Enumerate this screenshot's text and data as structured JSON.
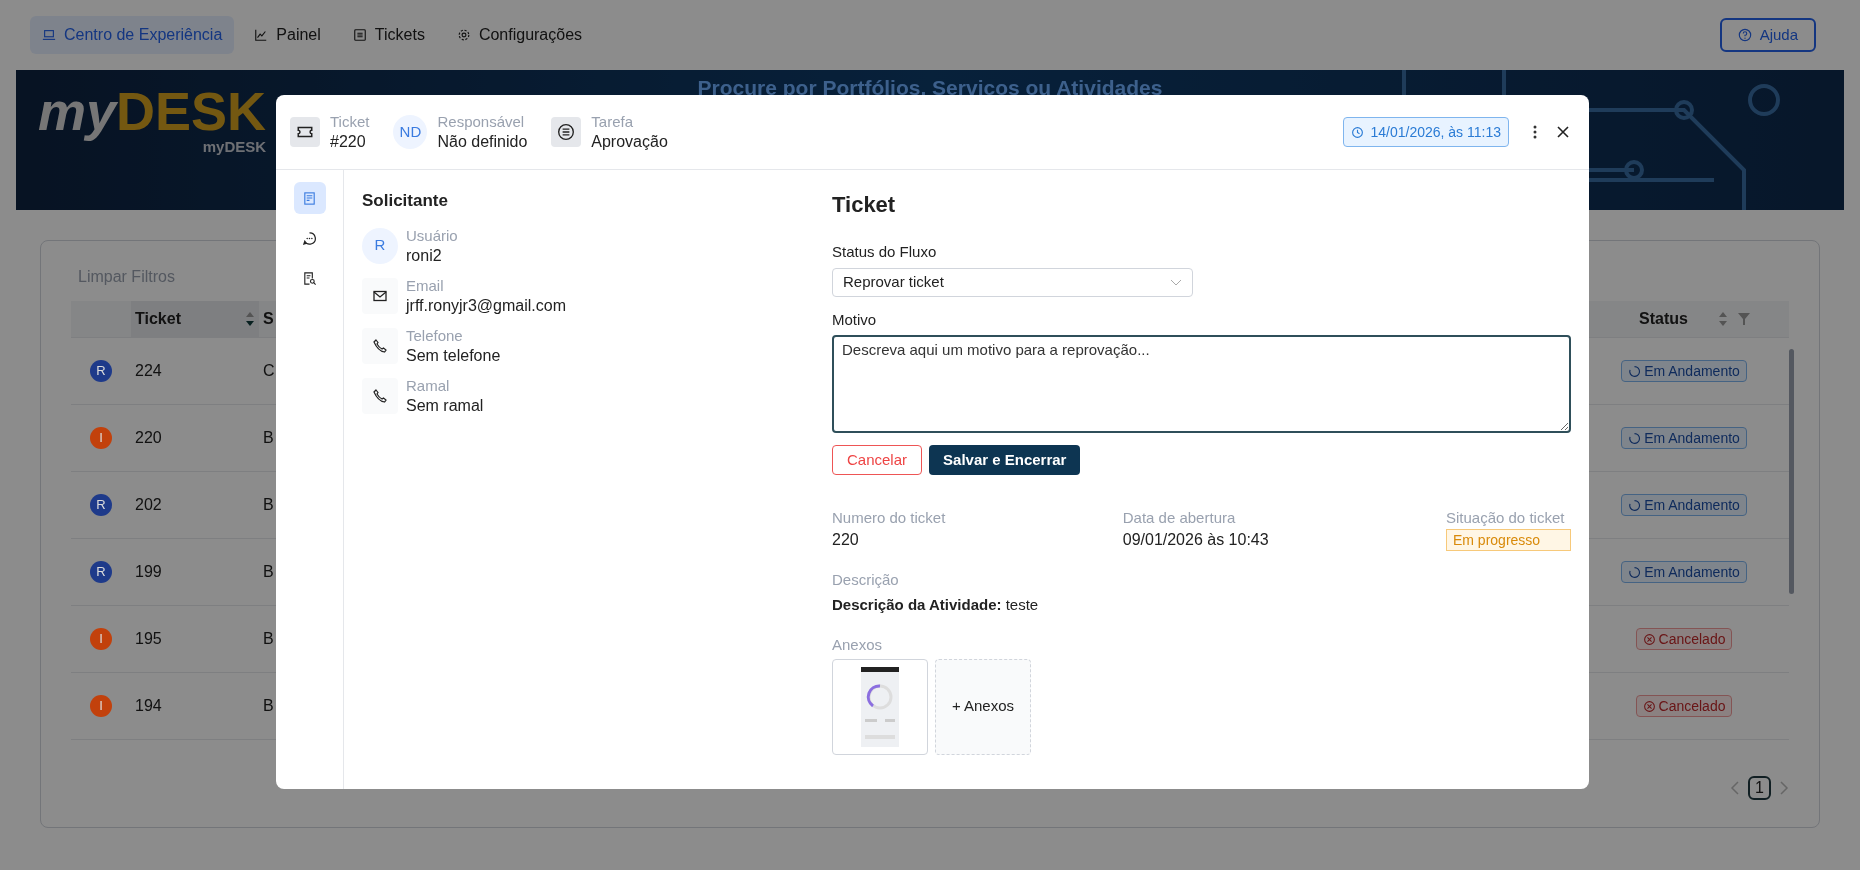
{
  "nav": {
    "tabs": [
      {
        "label": "Centro de Experiência",
        "selected": true
      },
      {
        "label": "Painel",
        "selected": false
      },
      {
        "label": "Tickets",
        "selected": false
      },
      {
        "label": "Configurações",
        "selected": false
      }
    ],
    "help_button": "Ajuda"
  },
  "banner": {
    "logo_my": "my",
    "logo_desk": "DESK",
    "logo_sub": "myDESK",
    "search_prompt": "Procure por Portfólios, Serviços ou Atividades"
  },
  "table": {
    "clear_filters": "Limpar Filtros",
    "columns": [
      "Ticket",
      "S",
      "Status"
    ],
    "rows": [
      {
        "avatar": "R",
        "color": "#1e3a8a",
        "ticket": "224",
        "column_3": "C",
        "status": "Em Andamento",
        "kind": "progress"
      },
      {
        "avatar": "I",
        "color": "#c2410c",
        "ticket": "220",
        "column_3": "B",
        "status": "Em Andamento",
        "kind": "progress"
      },
      {
        "avatar": "R",
        "color": "#1e3a8a",
        "ticket": "202",
        "column_3": "B",
        "status": "Em Andamento",
        "kind": "progress"
      },
      {
        "avatar": "R",
        "color": "#1e3a8a",
        "ticket": "199",
        "column_3": "B",
        "status": "Em Andamento",
        "kind": "progress"
      },
      {
        "avatar": "I",
        "color": "#c2410c",
        "ticket": "195",
        "column_3": "B",
        "status": "Cancelado",
        "kind": "cancelled"
      },
      {
        "avatar": "I",
        "color": "#c2410c",
        "ticket": "194",
        "column_3": "B",
        "status": "Cancelado",
        "kind": "cancelled"
      }
    ],
    "page": "1"
  },
  "modal": {
    "header": [
      {
        "kind": "icon",
        "label": "Ticket",
        "value": "#220"
      },
      {
        "kind": "avatar",
        "initials": "ND",
        "label": "Responsável",
        "value": "Não definido"
      },
      {
        "kind": "list",
        "label": "Tarefa",
        "value": "Aprovação"
      }
    ],
    "date": "14/01/2026, às 11:13",
    "rail": [
      {
        "selected": true
      },
      {
        "selected": false
      },
      {
        "selected": false
      }
    ],
    "requester": {
      "title": "Solicitante",
      "items": [
        {
          "kind": "avatar",
          "initials": "R",
          "label": "Usuário",
          "value": "roni2"
        },
        {
          "kind": "email",
          "label": "Email",
          "value": "jrff.ronyjr3@gmail.com"
        },
        {
          "kind": "phone",
          "label": "Telefone",
          "value": "Sem telefone"
        },
        {
          "kind": "phone",
          "label": "Ramal",
          "value": "Sem ramal"
        }
      ]
    },
    "ticket": {
      "title": "Ticket",
      "flow_label": "Status do Fluxo",
      "flow_value": "Reprovar ticket",
      "reason_label": "Motivo",
      "reason_value": "Descreva aqui um motivo para a reprovação...",
      "cancel_button": "Cancelar",
      "save_button": "Salvar e Encerrar",
      "info": [
        {
          "label": "Numero do ticket",
          "value": "220",
          "kind": "text"
        },
        {
          "label": "Data de abertura",
          "value": "09/01/2026 às 10:43",
          "kind": "text"
        },
        {
          "label": "Situação do ticket",
          "value": "Em progresso",
          "kind": "badge"
        }
      ],
      "description_label": "Descrição",
      "description": "**Descrição da Atividade:** teste",
      "attachments_label": "Anexos",
      "add_attachment": "+ Anexos"
    }
  }
}
